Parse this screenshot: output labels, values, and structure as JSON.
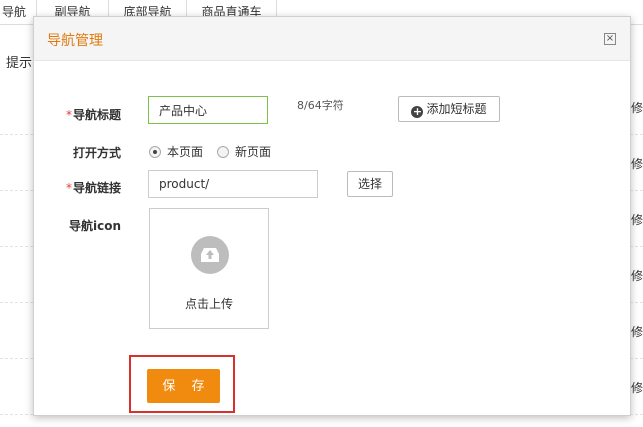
{
  "background": {
    "tabs": [
      "导航",
      "副导航",
      "底部导航",
      "商品直通车"
    ],
    "hint": "提示",
    "edit_label": "修"
  },
  "modal": {
    "title": "导航管理",
    "close_glyph": "×",
    "required_mark": "*",
    "fields": {
      "title_label": "导航标题",
      "title_value": "产品中心",
      "title_count": "8/64字符",
      "add_short_title": "添加短标题",
      "open_mode_label": "打开方式",
      "open_mode_options": [
        "本页面",
        "新页面"
      ],
      "open_mode_selected": "本页面",
      "link_label": "导航链接",
      "link_value": "product/",
      "select_button": "选择",
      "icon_label": "导航icon",
      "upload_text": "点击上传"
    },
    "save_button": "保 存"
  },
  "colors": {
    "accent": "#f18b0f",
    "title": "#e07a10",
    "required": "#e63b3b",
    "highlight": "#d9302c",
    "active_input_border": "#7cc04d"
  }
}
